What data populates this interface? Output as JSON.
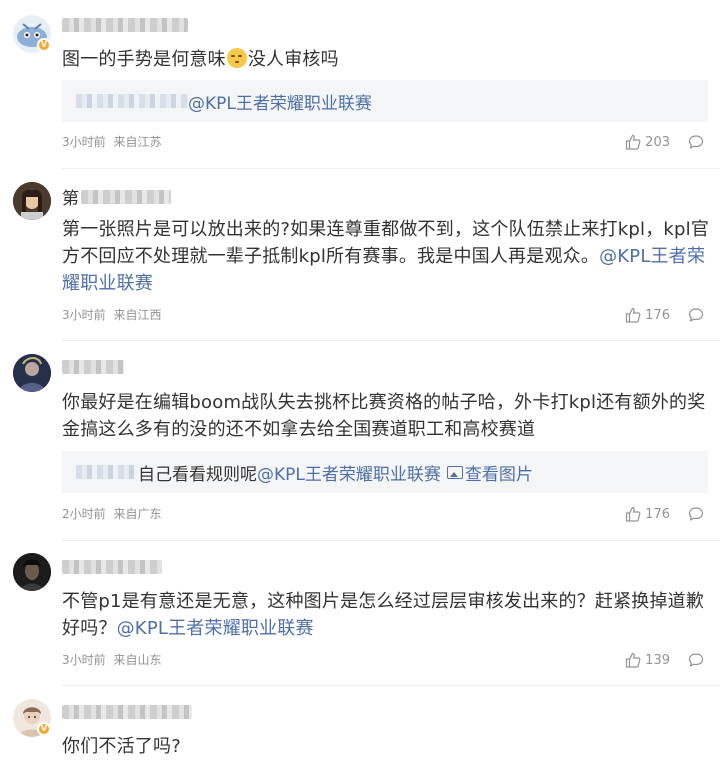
{
  "comments": [
    {
      "username_prefix": "",
      "text_before_emoji": "图一的手势是何意味",
      "text_after_emoji": "没人审核吗",
      "reply_mention": "@KPL王者荣耀职业联赛",
      "time": "3小时前",
      "location": "来自江苏",
      "likes": "203",
      "verified": true
    },
    {
      "username_prefix": "第",
      "text": "第一张照片是可以放出来的?如果连尊重都做不到，这个队伍禁止来打kpl，kpl官方不回应不处理就一辈子抵制kpl所有赛事。我是中国人再是观众。",
      "mention": "@KPL王者荣耀职业联赛",
      "time": "3小时前",
      "location": "来自江西",
      "likes": "176",
      "verified": false
    },
    {
      "username_prefix": "",
      "text": "你最好是在编辑boom战队失去挑杯比赛资格的帖子哈，外卡打kpl还有额外的奖金搞这么多有的没的还不如拿去给全国赛道职工和高校赛道",
      "reply_text": "自己看看规则呢",
      "reply_mention": "@KPL王者荣耀职业联赛",
      "reply_link": "查看图片",
      "time": "2小时前",
      "location": "来自广东",
      "likes": "176",
      "verified": false
    },
    {
      "username_prefix": "",
      "text": "不管p1是有意还是无意，这种图片是怎么经过层层审核发出来的？赶紧换掉道歉好吗？",
      "mention": "@KPL王者荣耀职业联赛",
      "time": "3小时前",
      "location": "来自山东",
      "likes": "139",
      "verified": false
    },
    {
      "username_prefix": "",
      "text": "你们不活了吗?",
      "verified": true
    }
  ],
  "colors": {
    "link": "#4e6fa8",
    "meta": "#939393",
    "text": "#333333",
    "badge": "#f7a52b"
  },
  "icons": [
    "like-icon",
    "comment-icon",
    "picture-icon",
    "verified-badge-icon"
  ]
}
